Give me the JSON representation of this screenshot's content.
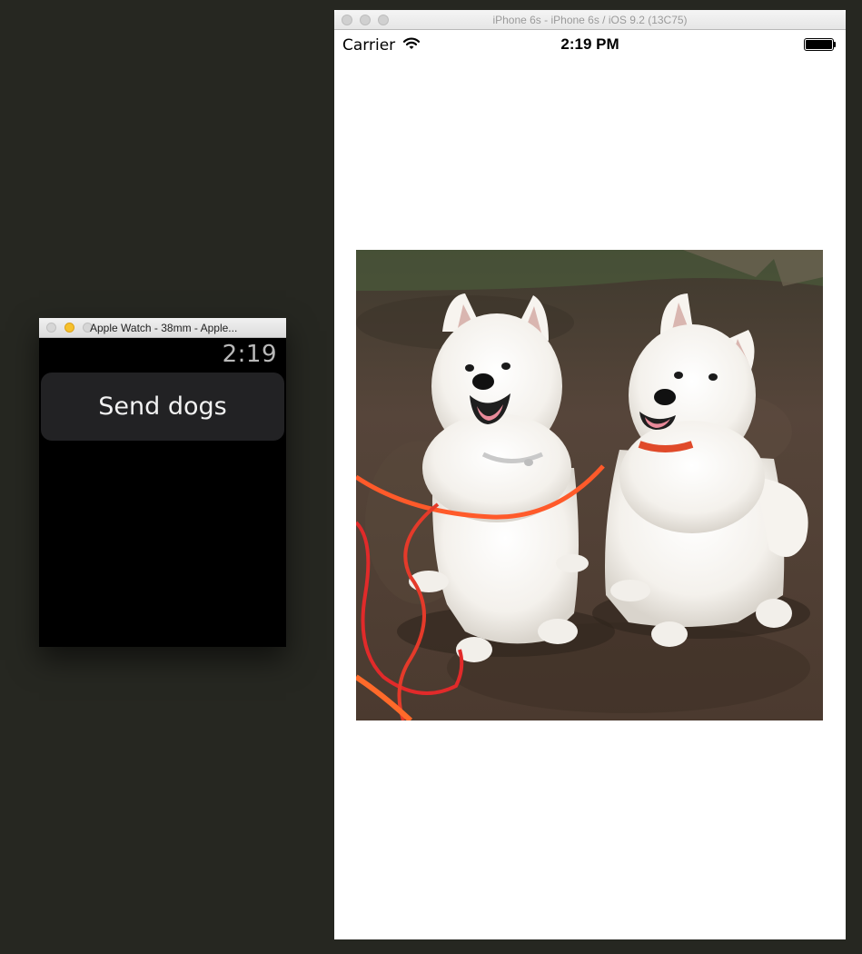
{
  "watch": {
    "window_title": "Apple Watch - 38mm - Apple...",
    "time": "2:19",
    "button_label": "Send dogs"
  },
  "iphone": {
    "window_title": "iPhone 6s - iPhone 6s / iOS 9.2 (13C75)",
    "status": {
      "carrier": "Carrier",
      "time": "2:19 PM"
    },
    "image_icon": "photo-of-two-white-samoyed-dogs"
  },
  "colors": {
    "desktop": "#262721",
    "watch_screen": "#000000",
    "watch_button": "#222224",
    "leash": "#ff5a2a",
    "ground": "#4a3a2e"
  }
}
